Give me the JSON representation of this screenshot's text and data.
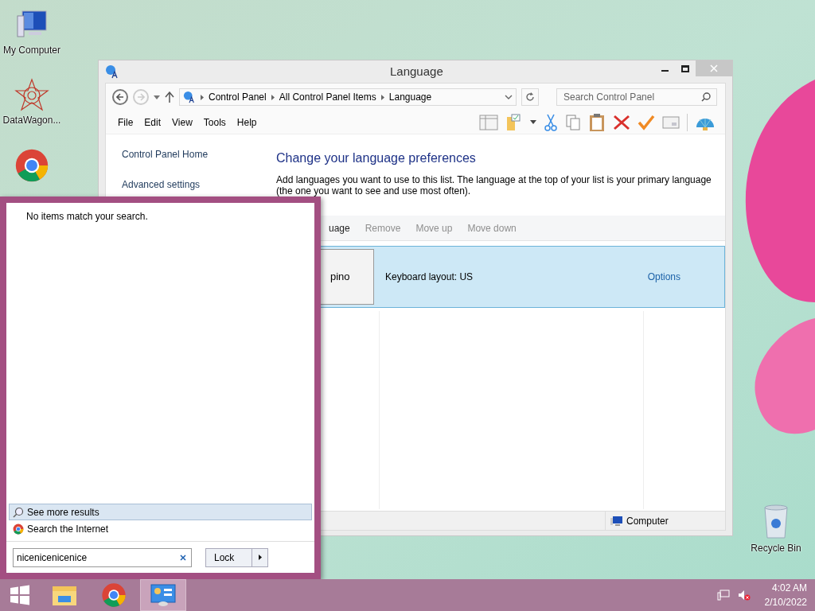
{
  "desktop_icons": [
    {
      "label": "My Computer",
      "kind": "computer"
    },
    {
      "label": "DataWagon...",
      "kind": "star"
    },
    {
      "label": "Recycle Bin",
      "kind": "bin"
    }
  ],
  "window": {
    "title": "Language",
    "nav": {
      "back_disabled": false,
      "forward_disabled": true,
      "breadcrumbs": [
        "Control Panel",
        "All Control Panel Items",
        "Language"
      ],
      "search_placeholder": "Search Control Panel"
    },
    "menu": [
      "File",
      "Edit",
      "View",
      "Tools",
      "Help"
    ],
    "sidebar": [
      "Control Panel Home",
      "Advanced settings"
    ],
    "heading": "Change your language preferences",
    "description": "Add languages you want to use to this list. The language at the top of your list is your primary language (the one you want to see and use most often).",
    "list_toolbar": [
      {
        "label": "uage",
        "disabled": false
      },
      {
        "label": "Remove",
        "disabled": true
      },
      {
        "label": "Move up",
        "disabled": true
      },
      {
        "label": "Move down",
        "disabled": true
      }
    ],
    "languages": [
      {
        "name": "pino",
        "keyboard": "Keyboard layout: US",
        "options": "Options",
        "selected": true
      }
    ],
    "status_bar": "Computer"
  },
  "start_menu": {
    "empty_message": "No items match your search.",
    "results": [
      {
        "label": "See more results",
        "kind": "search",
        "selected": true
      },
      {
        "label": "Search the Internet",
        "kind": "browser",
        "selected": false
      }
    ],
    "search_value": "nicenicenicenice",
    "power_button": "Lock"
  },
  "taskbar": {
    "items": [
      {
        "kind": "explorer",
        "active": false
      },
      {
        "kind": "browser",
        "active": false
      },
      {
        "kind": "control-panel",
        "active": true
      }
    ],
    "time": "4:02 AM",
    "date": "2/10/2022"
  }
}
